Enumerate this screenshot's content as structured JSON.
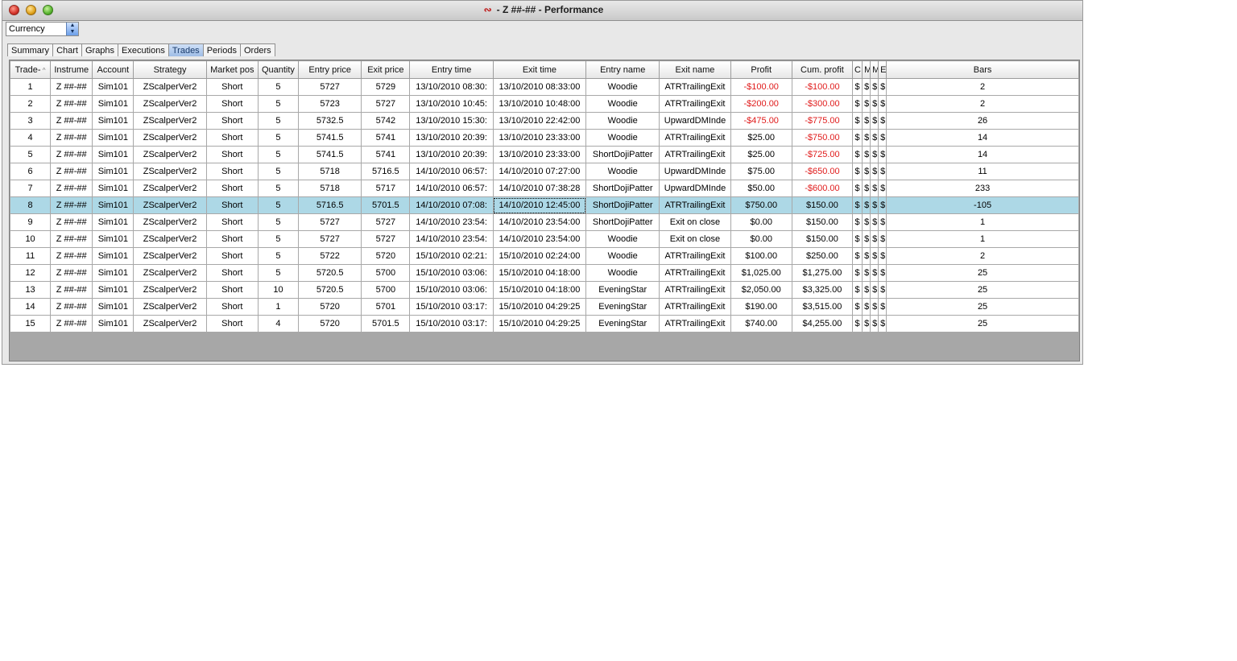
{
  "window": {
    "title": "- Z ##-## - Performance"
  },
  "currency": {
    "value": "Currency"
  },
  "tabs": [
    {
      "label": "Summary"
    },
    {
      "label": "Chart"
    },
    {
      "label": "Graphs"
    },
    {
      "label": "Executions"
    },
    {
      "label": "Trades",
      "active": true
    },
    {
      "label": "Periods"
    },
    {
      "label": "Orders"
    }
  ],
  "table": {
    "columns": [
      "Trade-",
      "Instrume",
      "Account",
      "Strategy",
      "Market pos",
      "Quantity",
      "Entry price",
      "Exit price",
      "Entry time",
      "Exit time",
      "Entry name",
      "Exit name",
      "Profit",
      "Cum. profit",
      "C",
      "M",
      "M",
      "E",
      "Bars"
    ],
    "sort_indicator": "^",
    "selected_row": 7,
    "focused_cell": [
      7,
      9
    ],
    "rows": [
      [
        "1",
        "Z ##-##",
        "Sim101",
        "ZScalperVer2",
        "Short",
        "5",
        "5727",
        "5729",
        "13/10/2010 08:30:",
        "13/10/2010 08:33:00",
        "Woodie",
        "ATRTrailingExit",
        "-$100.00",
        "-$100.00",
        "$",
        "$",
        "$",
        "$",
        "2"
      ],
      [
        "2",
        "Z ##-##",
        "Sim101",
        "ZScalperVer2",
        "Short",
        "5",
        "5723",
        "5727",
        "13/10/2010 10:45:",
        "13/10/2010 10:48:00",
        "Woodie",
        "ATRTrailingExit",
        "-$200.00",
        "-$300.00",
        "$",
        "$",
        "$",
        "$",
        "2"
      ],
      [
        "3",
        "Z ##-##",
        "Sim101",
        "ZScalperVer2",
        "Short",
        "5",
        "5732.5",
        "5742",
        "13/10/2010 15:30:",
        "13/10/2010 22:42:00",
        "Woodie",
        "UpwardDMInde",
        "-$475.00",
        "-$775.00",
        "$",
        "$",
        "$",
        "$",
        "26"
      ],
      [
        "4",
        "Z ##-##",
        "Sim101",
        "ZScalperVer2",
        "Short",
        "5",
        "5741.5",
        "5741",
        "13/10/2010 20:39:",
        "13/10/2010 23:33:00",
        "Woodie",
        "ATRTrailingExit",
        "$25.00",
        "-$750.00",
        "$",
        "$",
        "$",
        "$",
        "14"
      ],
      [
        "5",
        "Z ##-##",
        "Sim101",
        "ZScalperVer2",
        "Short",
        "5",
        "5741.5",
        "5741",
        "13/10/2010 20:39:",
        "13/10/2010 23:33:00",
        "ShortDojiPatter",
        "ATRTrailingExit",
        "$25.00",
        "-$725.00",
        "$",
        "$",
        "$",
        "$",
        "14"
      ],
      [
        "6",
        "Z ##-##",
        "Sim101",
        "ZScalperVer2",
        "Short",
        "5",
        "5718",
        "5716.5",
        "14/10/2010 06:57:",
        "14/10/2010 07:27:00",
        "Woodie",
        "UpwardDMInde",
        "$75.00",
        "-$650.00",
        "$",
        "$",
        "$",
        "$",
        "11"
      ],
      [
        "7",
        "Z ##-##",
        "Sim101",
        "ZScalperVer2",
        "Short",
        "5",
        "5718",
        "5717",
        "14/10/2010 06:57:",
        "14/10/2010 07:38:28",
        "ShortDojiPatter",
        "UpwardDMInde",
        "$50.00",
        "-$600.00",
        "$",
        "$",
        "$",
        "$",
        "233"
      ],
      [
        "8",
        "Z ##-##",
        "Sim101",
        "ZScalperVer2",
        "Short",
        "5",
        "5716.5",
        "5701.5",
        "14/10/2010 07:08:",
        "14/10/2010 12:45:00",
        "ShortDojiPatter",
        "ATRTrailingExit",
        "$750.00",
        "$150.00",
        "$",
        "$",
        "$",
        "$",
        "-105"
      ],
      [
        "9",
        "Z ##-##",
        "Sim101",
        "ZScalperVer2",
        "Short",
        "5",
        "5727",
        "5727",
        "14/10/2010 23:54:",
        "14/10/2010 23:54:00",
        "ShortDojiPatter",
        "Exit on close",
        "$0.00",
        "$150.00",
        "$",
        "$",
        "$",
        "$",
        "1"
      ],
      [
        "10",
        "Z ##-##",
        "Sim101",
        "ZScalperVer2",
        "Short",
        "5",
        "5727",
        "5727",
        "14/10/2010 23:54:",
        "14/10/2010 23:54:00",
        "Woodie",
        "Exit on close",
        "$0.00",
        "$150.00",
        "$",
        "$",
        "$",
        "$",
        "1"
      ],
      [
        "11",
        "Z ##-##",
        "Sim101",
        "ZScalperVer2",
        "Short",
        "5",
        "5722",
        "5720",
        "15/10/2010 02:21:",
        "15/10/2010 02:24:00",
        "Woodie",
        "ATRTrailingExit",
        "$100.00",
        "$250.00",
        "$",
        "$",
        "$",
        "$",
        "2"
      ],
      [
        "12",
        "Z ##-##",
        "Sim101",
        "ZScalperVer2",
        "Short",
        "5",
        "5720.5",
        "5700",
        "15/10/2010 03:06:",
        "15/10/2010 04:18:00",
        "Woodie",
        "ATRTrailingExit",
        "$1,025.00",
        "$1,275.00",
        "$",
        "$",
        "$",
        "$",
        "25"
      ],
      [
        "13",
        "Z ##-##",
        "Sim101",
        "ZScalperVer2",
        "Short",
        "10",
        "5720.5",
        "5700",
        "15/10/2010 03:06:",
        "15/10/2010 04:18:00",
        "EveningStar",
        "ATRTrailingExit",
        "$2,050.00",
        "$3,325.00",
        "$",
        "$",
        "$",
        "$",
        "25"
      ],
      [
        "14",
        "Z ##-##",
        "Sim101",
        "ZScalperVer2",
        "Short",
        "1",
        "5720",
        "5701",
        "15/10/2010 03:17:",
        "15/10/2010 04:29:25",
        "EveningStar",
        "ATRTrailingExit",
        "$190.00",
        "$3,515.00",
        "$",
        "$",
        "$",
        "$",
        "25"
      ],
      [
        "15",
        "Z ##-##",
        "Sim101",
        "ZScalperVer2",
        "Short",
        "4",
        "5720",
        "5701.5",
        "15/10/2010 03:17:",
        "15/10/2010 04:29:25",
        "EveningStar",
        "ATRTrailingExit",
        "$740.00",
        "$4,255.00",
        "$",
        "$",
        "$",
        "$",
        "25"
      ]
    ]
  },
  "colors": {
    "selected_row": "#add8e6",
    "negative": "#e01b1b",
    "active_tab": "#9fbde6"
  }
}
